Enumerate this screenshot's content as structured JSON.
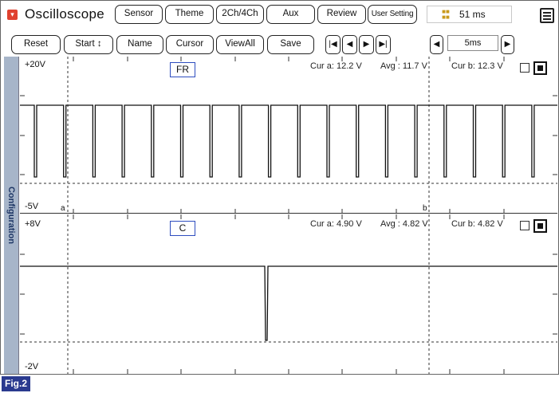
{
  "app": {
    "title": "Oscilloscope",
    "time_value": "51 ms"
  },
  "toolbar1": {
    "sensor": "Sensor",
    "theme": "Theme",
    "ch": "2Ch/4Ch",
    "aux": "Aux",
    "review": "Review",
    "user_setting": "User Setting"
  },
  "toolbar2": {
    "reset": "Reset",
    "start": "Start ↕",
    "name": "Name",
    "cursor": "Cursor",
    "viewall": "ViewAll",
    "save": "Save",
    "timebase": "5ms"
  },
  "sidebar": {
    "label": "Configuration"
  },
  "channel1": {
    "tag": "FR",
    "y_max": "+20V",
    "y_min": "-5V",
    "cur_a": "Cur a: 12.2 V",
    "avg": "Avg  : 11.7 V",
    "cur_b": "Cur b: 12.3 V",
    "cursor_a": "a",
    "cursor_b": "b"
  },
  "channel2": {
    "tag": "C",
    "y_max": "+8V",
    "y_min": "-2V",
    "cur_a": "Cur a: 4.90 V",
    "avg": "Avg  : 4.82 V",
    "cur_b": "Cur b: 4.82 V"
  },
  "figure_label": "Fig.2",
  "colors": {
    "tag_border": "#2e4dbf",
    "sidebar": "#a7b5c9",
    "fig_bg": "#2a3a8f",
    "icon_red": "#e0412f"
  },
  "icons": [
    "app-menu-icon",
    "timer-icon",
    "window-menu-icon",
    "skip-start-icon",
    "step-back-icon",
    "step-forward-icon",
    "skip-end-icon",
    "decrease-icon",
    "increase-icon"
  ]
}
